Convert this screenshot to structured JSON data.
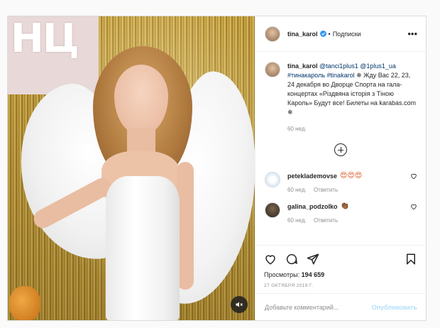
{
  "header": {
    "username": "tina_karol",
    "separator": "•",
    "follow_label": "Подписки",
    "more_label": "•••"
  },
  "caption": {
    "username": "tina_karol",
    "mention1": "@tanci1plus1",
    "mention2": "@1plus1_ua",
    "hashtag1": "#тинакароль",
    "hashtag2": "#tinakarol",
    "snowflake": "❄",
    "text": "Жду Вас 22, 23, 24 декабря во Дворце Спорта на гала-концертах «Різдвяна історія з Тіною Кароль» Будут все! Билеты на karabas.com",
    "time": "60 нед."
  },
  "comments": [
    {
      "username": "peteklademovse",
      "emoji": "😍😍😍",
      "time": "60 нед.",
      "reply_label": "Ответить"
    },
    {
      "username": "galina_podzolko",
      "emoji": "👏🏾",
      "time": "60 нед.",
      "reply_label": "Ответить"
    }
  ],
  "stats": {
    "views_label": "Просмотры:",
    "views_value": "194 659",
    "date": "27 ОКТЯБРЯ 2019 Г."
  },
  "add_comment": {
    "placeholder": "Добавьте комментарий...",
    "publish_label": "Опубликовать"
  },
  "colors": {
    "verified": "#3897f0",
    "link": "#00376b",
    "publish_disabled": "#b2dffc"
  },
  "icons": [
    "verified-icon",
    "more-icon",
    "add-icon",
    "heart-icon",
    "comment-icon",
    "share-icon",
    "save-icon",
    "mute-icon"
  ]
}
